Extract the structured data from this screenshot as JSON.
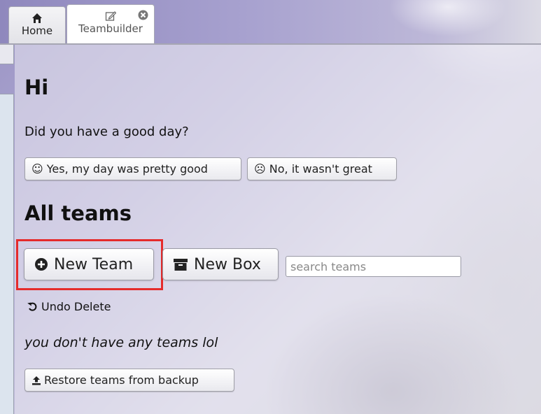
{
  "tabs": [
    {
      "label": "Home",
      "icon": "home-icon"
    },
    {
      "label": "Teambuilder",
      "icon": "edit-icon",
      "closable": true
    }
  ],
  "main": {
    "greeting_title": "Hi",
    "question": "Did you have a good day?",
    "yes_button": "☺ Yes, my day was pretty good",
    "no_button": "☹ No, it wasn't great",
    "section_title": "All teams",
    "new_team_button": "New Team",
    "new_box_button": "New Box",
    "search": {
      "placeholder": "search teams",
      "value": ""
    },
    "undo_button": "Undo Delete",
    "empty_message": "you don't have any teams lol",
    "restore_button": "Restore teams from backup"
  },
  "colors": {
    "highlight": "#e52b2b"
  }
}
